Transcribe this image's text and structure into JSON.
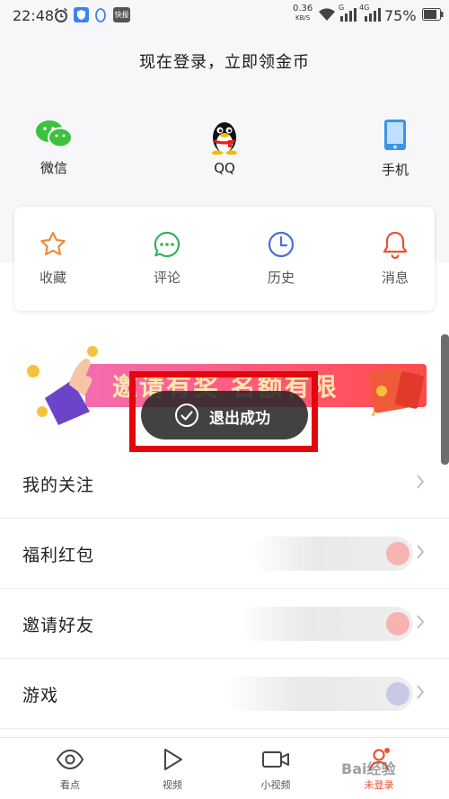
{
  "status_bar": {
    "time": "22:48",
    "speed_value": "0.36",
    "speed_unit": "KB/S",
    "network_1": "G",
    "network_2": "4G",
    "battery": "75%",
    "icons": [
      "alarm-icon",
      "shield-app-icon",
      "qq-penguin-icon",
      "kuaibao-app-icon",
      "wifi-icon",
      "signal-icon",
      "battery-icon"
    ]
  },
  "header": {
    "title": "现在登录，立即领金币",
    "login_options": [
      {
        "label": "微信",
        "icon": "wechat-icon"
      },
      {
        "label": "QQ",
        "icon": "qq-icon"
      },
      {
        "label": "手机",
        "icon": "phone-icon"
      }
    ]
  },
  "quick_actions": [
    {
      "label": "收藏",
      "icon": "star-icon",
      "color": "#f08a3a"
    },
    {
      "label": "评论",
      "icon": "comment-icon",
      "color": "#36b25a"
    },
    {
      "label": "历史",
      "icon": "clock-icon",
      "color": "#4a6fd6"
    },
    {
      "label": "消息",
      "icon": "bell-icon",
      "color": "#e8532f"
    }
  ],
  "banner": {
    "text": "邀请有奖 名额有限"
  },
  "toast": {
    "text": "退出成功",
    "icon": "check-circle-icon"
  },
  "menu": [
    {
      "label": "我的关注"
    },
    {
      "label": "福利红包"
    },
    {
      "label": "邀请好友"
    },
    {
      "label": "游戏"
    }
  ],
  "bottom_nav": [
    {
      "label": "看点",
      "icon": "eye-icon"
    },
    {
      "label": "视频",
      "icon": "play-icon"
    },
    {
      "label": "小视频",
      "icon": "video-camera-icon"
    },
    {
      "label": "未登录",
      "icon": "user-icon",
      "active": true
    }
  ],
  "watermark": "Bai经验",
  "colors": {
    "accent_red": "#e4060c",
    "active_nav": "#e8532f",
    "wechat_green": "#3cc23c",
    "phone_blue": "#3a95e8"
  }
}
